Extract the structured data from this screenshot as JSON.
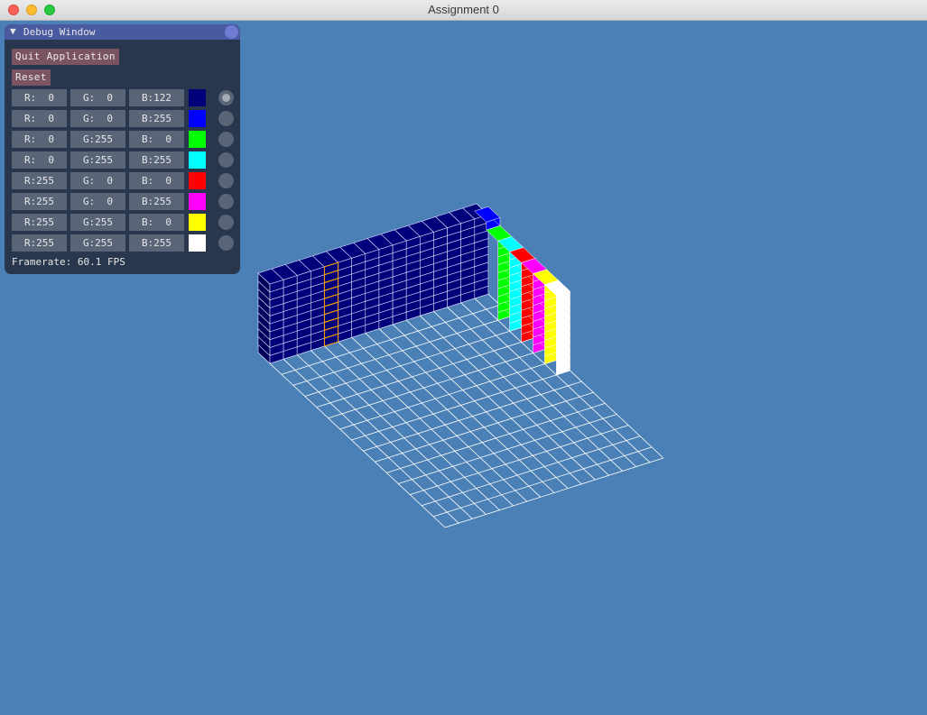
{
  "window": {
    "title": "Assignment 0"
  },
  "debug": {
    "title": "Debug Window",
    "quit_label": "Quit Application",
    "reset_label": "Reset",
    "framerate": "Framerate: 60.1 FPS",
    "colors": [
      {
        "r": "R:  0",
        "g": "G:  0",
        "b": "B:122",
        "hex": "#00007a",
        "selected": true
      },
      {
        "r": "R:  0",
        "g": "G:  0",
        "b": "B:255",
        "hex": "#0000ff",
        "selected": false
      },
      {
        "r": "R:  0",
        "g": "G:255",
        "b": "B:  0",
        "hex": "#00ff00",
        "selected": false
      },
      {
        "r": "R:  0",
        "g": "G:255",
        "b": "B:255",
        "hex": "#00ffff",
        "selected": false
      },
      {
        "r": "R:255",
        "g": "G:  0",
        "b": "B:  0",
        "hex": "#ff0000",
        "selected": false
      },
      {
        "r": "R:255",
        "g": "G:  0",
        "b": "B:255",
        "hex": "#ff00ff",
        "selected": false
      },
      {
        "r": "R:255",
        "g": "G:255",
        "b": "B:  0",
        "hex": "#ffff00",
        "selected": false
      },
      {
        "r": "R:255",
        "g": "G:255",
        "b": "B:255",
        "hex": "#ffffff",
        "selected": false
      }
    ]
  },
  "scene": {
    "background": "#4a80b5",
    "grid_size": 16,
    "wall_color": "#00007a",
    "wall_columns": 16,
    "wall_rows": 10,
    "cursor_column": 4,
    "cursor_color": "#ffa000",
    "pillar_colors": [
      "#0000ff",
      "#00ff00",
      "#00ffff",
      "#ff0000",
      "#ff00ff",
      "#ffff00",
      "#ffffff"
    ]
  }
}
